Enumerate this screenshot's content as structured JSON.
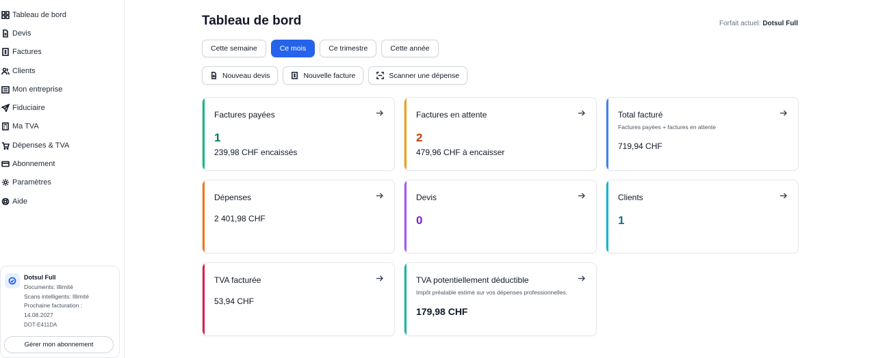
{
  "sidebar": {
    "items": [
      {
        "label": "Tableau de bord",
        "icon": "dashboard-icon"
      },
      {
        "label": "Devis",
        "icon": "document-icon"
      },
      {
        "label": "Factures",
        "icon": "invoice-icon"
      },
      {
        "label": "Clients",
        "icon": "users-icon"
      },
      {
        "label": "Mon entreprise",
        "icon": "building-icon"
      },
      {
        "label": "Fiduciaire",
        "icon": "send-icon"
      },
      {
        "label": "Ma TVA",
        "icon": "calculator-icon"
      },
      {
        "label": "Dépenses & TVA",
        "icon": "cart-icon"
      },
      {
        "label": "Abonnement",
        "icon": "credit-card-icon"
      },
      {
        "label": "Paramètres",
        "icon": "gear-icon"
      },
      {
        "label": "Aide",
        "icon": "lifebuoy-icon"
      }
    ],
    "plan": {
      "name": "Dotsul Full",
      "documents": "Documents: Illimité",
      "scans": "Scans intelligents: Illimité",
      "next_billing_label": "Prochaine facturation :",
      "next_billing_date": "14.08.2027",
      "code": "DOT-E411DA",
      "manage_label": "Gérer mon abonnement"
    }
  },
  "header": {
    "title": "Tableau de bord",
    "plan_prefix": "Forfait actuel: ",
    "plan_name": "Dotsul Full"
  },
  "tabs": [
    {
      "label": "Cette semaine",
      "active": false
    },
    {
      "label": "Ce mois",
      "active": true
    },
    {
      "label": "Ce trimestre",
      "active": false
    },
    {
      "label": "Cette année",
      "active": false
    }
  ],
  "actions": [
    {
      "label": "Nouveau devis",
      "icon": "file-plus-icon"
    },
    {
      "label": "Nouvelle facture",
      "icon": "invoice-icon"
    },
    {
      "label": "Scanner une dépense",
      "icon": "scan-icon"
    }
  ],
  "cards": {
    "paid": {
      "title": "Factures payées",
      "count": "1",
      "amount": "239,98 CHF encaissés",
      "accent": "#10b981",
      "value_color": "#047857"
    },
    "pending": {
      "title": "Factures en attente",
      "count": "2",
      "amount": "479,96 CHF à encaisser",
      "accent": "#f59e0b",
      "value_color": "#c2410c"
    },
    "total": {
      "title": "Total facturé",
      "subtitle": "Factures payées + factures en attente",
      "amount": "719,94 CHF",
      "accent": "#3b82f6"
    },
    "expenses": {
      "title": "Dépenses",
      "amount": "2 401,98 CHF",
      "accent": "#f97316"
    },
    "quotes": {
      "title": "Devis",
      "count": "0",
      "accent": "#a855f7",
      "value_color": "#7e22ce"
    },
    "clients": {
      "title": "Clients",
      "count": "1",
      "accent": "#06b6d4",
      "value_color": "#0e7490"
    },
    "vat_billed": {
      "title": "TVA facturée",
      "amount": "53,94 CHF",
      "accent": "#e11d48"
    },
    "vat_deductible": {
      "title": "TVA potentiellement déductible",
      "subtitle": "Impôt préalable estimé sur vos dépenses professionnelles.",
      "amount": "179,98 CHF",
      "accent": "#14b8a6"
    }
  }
}
